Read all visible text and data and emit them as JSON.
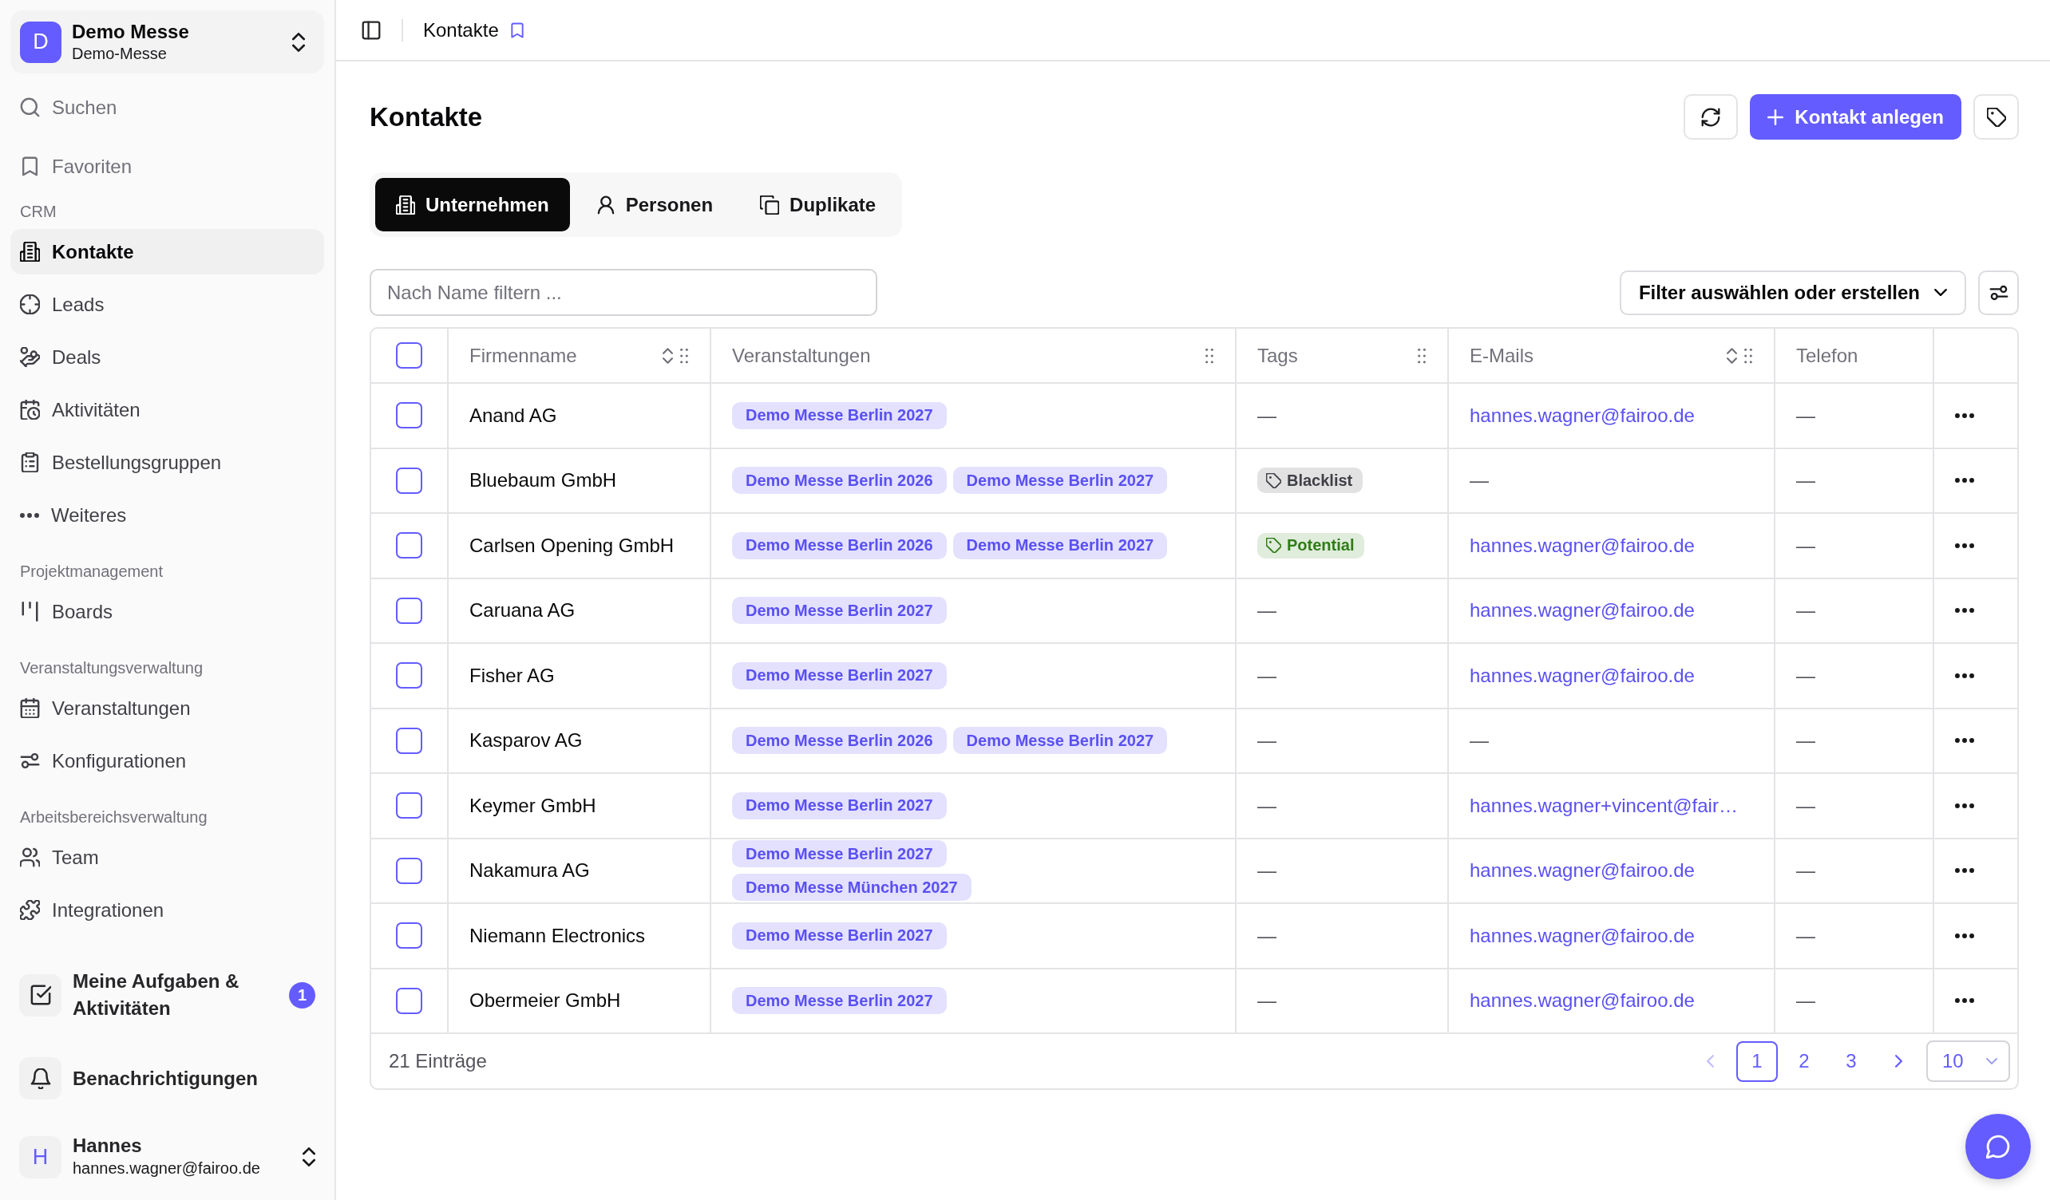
{
  "sidebar": {
    "workspace": {
      "avatar": "D",
      "name": "Demo Messe",
      "subtitle": "Demo-Messe"
    },
    "quick_links": [
      {
        "label": "Suchen"
      },
      {
        "label": "Favoriten"
      }
    ],
    "sections": [
      {
        "title": "CRM",
        "items": [
          {
            "label": "Kontakte",
            "selected": true
          },
          {
            "label": "Leads",
            "selected": false
          },
          {
            "label": "Deals",
            "selected": false
          },
          {
            "label": "Aktivitäten",
            "selected": false
          },
          {
            "label": "Bestellungsgruppen",
            "selected": false
          },
          {
            "label": "Weiteres",
            "selected": false
          }
        ]
      },
      {
        "title": "Projektmanagement",
        "items": [
          {
            "label": "Boards",
            "selected": false
          }
        ]
      },
      {
        "title": "Veranstaltungsverwaltung",
        "items": [
          {
            "label": "Veranstaltungen",
            "selected": false
          },
          {
            "label": "Konfigurationen",
            "selected": false
          }
        ]
      },
      {
        "title": "Arbeitsbereichsverwaltung",
        "items": [
          {
            "label": "Team",
            "selected": false
          },
          {
            "label": "Integrationen",
            "selected": false
          }
        ]
      }
    ],
    "tasks": {
      "label": "Meine Aufgaben & Aktivitäten",
      "badge": "1"
    },
    "notifications": {
      "label": "Benachrichtigungen"
    },
    "user": {
      "avatar": "H",
      "name": "Hannes",
      "email": "hannes.wagner@fairoo.de"
    }
  },
  "header": {
    "breadcrumb": "Kontakte"
  },
  "page": {
    "title": "Kontakte",
    "create_button": "Kontakt anlegen",
    "tabs": [
      {
        "label": "Unternehmen",
        "selected": true
      },
      {
        "label": "Personen",
        "selected": false
      },
      {
        "label": "Duplikate",
        "selected": false
      }
    ],
    "name_filter": {
      "placeholder": "Nach Name filtern ..."
    },
    "filter_select": {
      "label": "Filter auswählen oder erstellen"
    },
    "table": {
      "select_all": {
        "checked": false
      },
      "columns": [
        {
          "label": "Firmenname",
          "sortable": true,
          "movable": true
        },
        {
          "label": "Veranstaltungen",
          "sortable": false,
          "movable": true
        },
        {
          "label": "Tags",
          "sortable": false,
          "movable": true
        },
        {
          "label": "E-Mails",
          "sortable": true,
          "movable": true
        },
        {
          "label": "Telefon",
          "sortable": false,
          "movable": false
        }
      ],
      "rows": [
        {
          "checked": false,
          "company": "Anand AG",
          "events": [
            "Demo Messe Berlin 2027"
          ],
          "tags": "—",
          "emails": [
            "hannes.wagner@fairoo.de"
          ],
          "phone": "—"
        },
        {
          "checked": false,
          "company": "Bluebaum GmbH",
          "events": [
            "Demo Messe Berlin 2026",
            "Demo Messe Berlin 2027"
          ],
          "tags": [
            {
              "label": "Blacklist",
              "color": "#3f3f46"
            }
          ],
          "emails": "—",
          "phone": "—"
        },
        {
          "checked": false,
          "company": "Carlsen Opening GmbH",
          "events": [
            "Demo Messe Berlin 2026",
            "Demo Messe Berlin 2027"
          ],
          "tags": [
            {
              "label": "Potential",
              "color": "#2f7d16"
            }
          ],
          "emails": [
            "hannes.wagner@fairoo.de"
          ],
          "phone": "—"
        },
        {
          "checked": false,
          "company": "Caruana AG",
          "events": [
            "Demo Messe Berlin 2027"
          ],
          "tags": "—",
          "emails": [
            "hannes.wagner@fairoo.de"
          ],
          "phone": "—"
        },
        {
          "checked": false,
          "company": "Fisher AG",
          "events": [
            "Demo Messe Berlin 2027"
          ],
          "tags": "—",
          "emails": [
            "hannes.wagner@fairoo.de"
          ],
          "phone": "—"
        },
        {
          "checked": false,
          "company": "Kasparov AG",
          "events": [
            "Demo Messe Berlin 2026",
            "Demo Messe Berlin 2027"
          ],
          "tags": "—",
          "emails": "—",
          "phone": "—"
        },
        {
          "checked": false,
          "company": "Keymer GmbH",
          "events": [
            "Demo Messe Berlin 2027"
          ],
          "tags": "—",
          "emails": [
            "hannes.wagner+vincent@fair…"
          ],
          "phone": "—"
        },
        {
          "checked": false,
          "company": "Nakamura AG",
          "events": [
            "Demo Messe Berlin 2027",
            "Demo Messe München 2027"
          ],
          "tags": "—",
          "emails": [
            "hannes.wagner@fairoo.de"
          ],
          "phone": "—"
        },
        {
          "checked": false,
          "company": "Niemann Electronics",
          "events": [
            "Demo Messe Berlin 2027"
          ],
          "tags": "—",
          "emails": [
            "hannes.wagner@fairoo.de"
          ],
          "phone": "—"
        },
        {
          "checked": false,
          "company": "Obermeier GmbH",
          "events": [
            "Demo Messe Berlin 2027"
          ],
          "tags": "—",
          "emails": [
            "hannes.wagner@fairoo.de"
          ],
          "phone": "—"
        }
      ],
      "footer": {
        "count": "21 Einträge",
        "previous": {
          "disabled": true
        },
        "pages": [
          {
            "label": "1",
            "selected": true
          },
          {
            "label": "2",
            "selected": false
          },
          {
            "label": "3",
            "selected": false
          }
        ],
        "next": {
          "disabled": false
        },
        "page_size": "10"
      }
    }
  }
}
